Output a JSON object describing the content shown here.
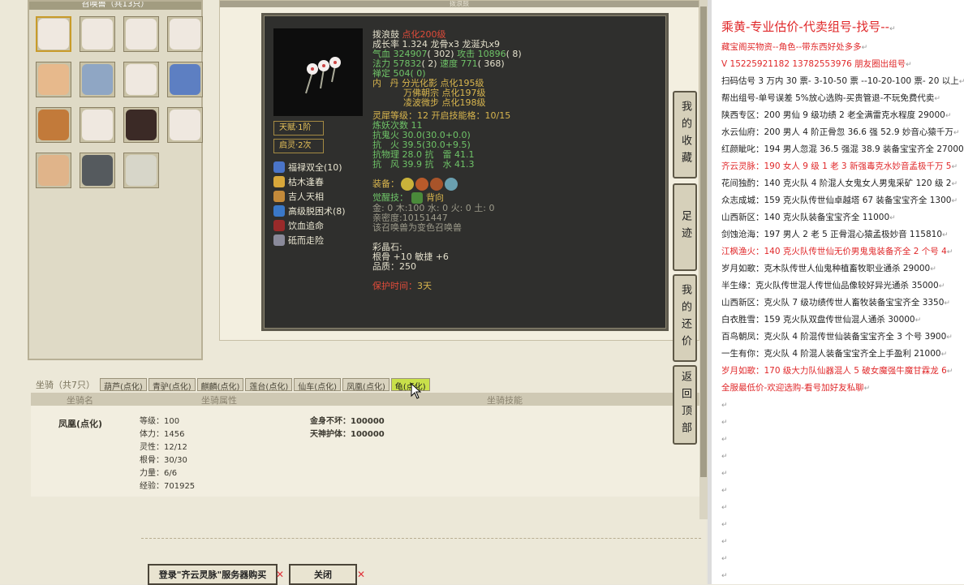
{
  "pet_panel": {
    "title": "召唤兽（共13只）",
    "pets": [
      {
        "color": "#efe8e0",
        "selected": true
      },
      {
        "color": "#efe8e0",
        "selected": false
      },
      {
        "color": "#efe8e0",
        "selected": false
      },
      {
        "color": "#efe8e0",
        "selected": false
      },
      {
        "color": "#e7b98c",
        "selected": false
      },
      {
        "color": "#8fa6c4",
        "selected": false
      },
      {
        "color": "#efe8e0",
        "selected": false
      },
      {
        "color": "#5d7fc2",
        "selected": false
      },
      {
        "color": "#c27a3a",
        "selected": false
      },
      {
        "color": "#efe8e0",
        "selected": false
      },
      {
        "color": "#3b2a26",
        "selected": false
      },
      {
        "color": "#efe8e0",
        "selected": false
      },
      {
        "color": "#e0b48a",
        "selected": false
      },
      {
        "color": "#555a5e",
        "selected": false
      },
      {
        "color": "#d7d6c9",
        "selected": false
      }
    ]
  },
  "info": {
    "panel_title": "拨浪鼓",
    "name": "拨浪鼓",
    "name_tag": "点化200级",
    "growth_line": "成长率 1.324 龙骨x3 龙涎丸x9",
    "hp_label": "气血",
    "hp_value": "324907",
    "hp_extra": "( 302)",
    "atk_label": "攻击",
    "atk_value": "10896",
    "atk_extra": "( 8)",
    "mp_label": "法力",
    "mp_value": "57832",
    "mp_extra": "( 2)",
    "spd_label": "速度",
    "spd_value": "771",
    "spd_extra": "( 368)",
    "zen_label": "禅定",
    "zen_value": "504",
    "zen_extra": "( 0)",
    "inner_label": "内",
    "inner_1": "丹 分光化影 点化195级",
    "inner_2": "万佛朝宗 点化197级",
    "inner_3": "凌波微步 点化198级",
    "tag_tianfu": "天赋·1阶",
    "tag_qiling": "启灵·2次",
    "lingxi": "灵犀等级：12 开启技能格：10/15",
    "lianyao": "炼妖次数 11",
    "kang1": "抗鬼火 30.0(30.0+0.0)",
    "kang2": "抗　火 39.5(30.0+9.5)",
    "kang3": "抗物理 28.0 抗　雷 41.1",
    "kang4": "抗　风 39.9 抗　水 41.3",
    "equip_label": "装备：",
    "awaken_label": "觉醒技：",
    "awaken_value": "背向",
    "element_line": "金: 0 木:100 水: 0 火: 0 土: 0",
    "intimacy": "亲密度:10151447",
    "color_note": "该召唤兽为变色召唤兽",
    "crystal_label": "彩晶石:",
    "crystal_bonus": "根骨 +10 敏捷 +6",
    "quality": "品质：250",
    "protect_label": "保护时间：",
    "protect_value": "3天",
    "skills": [
      {
        "name": "福禄双全(10)",
        "color": "#4a74c8"
      },
      {
        "name": "枯木逢春",
        "color": "#d8a73a"
      },
      {
        "name": "吉人天相",
        "color": "#c48a3a"
      },
      {
        "name": "高级脱困术(8)",
        "color": "#3a78c8"
      },
      {
        "name": "饮血追命",
        "color": "#9a2a2a"
      },
      {
        "name": "砥而走险",
        "color": "#8a8a9a"
      }
    ],
    "equip_colors": [
      "#c9b23a",
      "#b85a2a",
      "#a8542a",
      "#6aa0b0"
    ]
  },
  "mount": {
    "title": "坐骑（共7只）",
    "tabs": [
      "葫芦(点化)",
      "青驴(点化)",
      "麒麟(点化)",
      "莲台(点化)",
      "仙车(点化)",
      "凤凰(点化)",
      "龟(点化)"
    ],
    "active_tab": 6,
    "header": {
      "col1": "坐骑名",
      "col2": "坐骑属性",
      "col3": "坐骑技能"
    },
    "name": "凤凰(点化)",
    "attrs": [
      "等级：100",
      "体力：1456",
      "灵性：12/12",
      "根骨：30/30",
      "力量：6/6",
      "经验：701925"
    ],
    "skills": [
      "金身不坏：100000",
      "天神护体：100000"
    ]
  },
  "buttons": {
    "login": "登录\"齐云灵脉\"服务器购买",
    "close": "关闭"
  },
  "side_nav": [
    "我的收藏",
    "足迹",
    "我的还价",
    "返回顶部"
  ],
  "right_panel": {
    "lines": [
      {
        "text": "乘黄-专业估价-代卖组号-找号--",
        "red": true,
        "big": true
      },
      {
        "text": "藏宝阁买物资--角色--带东西好处多多",
        "red": true
      },
      {
        "text": "V 15225921182    13782553976 朋友圈出组号",
        "red": true
      },
      {
        "text": "扫码估号 3 万内 30 票- 3-10-50 票 --10-20-100 票- 20 以上",
        "red": false
      },
      {
        "text": "帮出组号-单号误差 5%放心选购-买贵管退-不玩免费代卖",
        "red": false
      },
      {
        "text": "陕西专区：200 男仙 9 级功绩 2 老全满雷克水程度 29000",
        "red": false
      },
      {
        "text": "水云仙府：200 男人 4 阶正骨忽 36.6 强 52.9 妙音心猿千万",
        "red": false
      },
      {
        "text": "红颜眦叱：194 男人忽混 36.5 强混 38.9 装备宝宝齐全 27000",
        "red": false
      },
      {
        "text": "齐云灵脉：190 女人 9 级 1 老 3 新强毒克水妙音孟极千万 5",
        "red": true
      },
      {
        "text": "花间独酌：140 克火队 4 阶混人女鬼女人男鬼采矿 120 级 2",
        "red": false
      },
      {
        "text": "众志成城：159 克火队传世仙卓越塔 67 装备宝宝齐全 1300",
        "red": false
      },
      {
        "text": "山西新区：140 克火队装备宝宝齐全 11000",
        "red": false
      },
      {
        "text": "剑蚀沧海：197 男人 2 老 5 正骨混心猿孟极妙音 115810",
        "red": false
      },
      {
        "text": "江枫渔火：140 克火队传世仙无价男鬼鬼装备齐全 2 个号 4",
        "red": true
      },
      {
        "text": "岁月如歌：克木队传世人仙鬼种植畜牧职业通杀 29000",
        "red": false
      },
      {
        "text": "半生缘：克火队传世混人传世仙品像较好异光通杀 35000",
        "red": false
      },
      {
        "text": "山西新区：克火队 7 级功绩传世人畜牧装备宝宝齐全 3350",
        "red": false
      },
      {
        "text": "白衣胜雪：159 克火队双盘传世仙混人通杀 30000",
        "red": false
      },
      {
        "text": "百鸟朝凤：克火队 4 阶混传世仙装备宝宝齐全 3 个号 3900",
        "red": false
      },
      {
        "text": "一生有你：克火队 4 阶混人装备宝宝齐全上手盈利 21000",
        "red": false
      },
      {
        "text": "岁月如歌：170 级大力队仙器混人 5 破女魔强牛魔甘霖龙 6",
        "red": true
      },
      {
        "text": "全服最低价-欢迎选购-看号加好友私聊",
        "red": true
      },
      {
        "text": "",
        "red": false
      },
      {
        "text": "",
        "red": false
      },
      {
        "text": "",
        "red": false
      },
      {
        "text": "",
        "red": false
      },
      {
        "text": "",
        "red": false
      },
      {
        "text": "",
        "red": false
      },
      {
        "text": "",
        "red": false
      },
      {
        "text": "",
        "red": false
      },
      {
        "text": "",
        "red": false
      },
      {
        "text": "",
        "red": false
      },
      {
        "text": "",
        "red": false
      },
      {
        "text": "",
        "red": false
      }
    ]
  }
}
